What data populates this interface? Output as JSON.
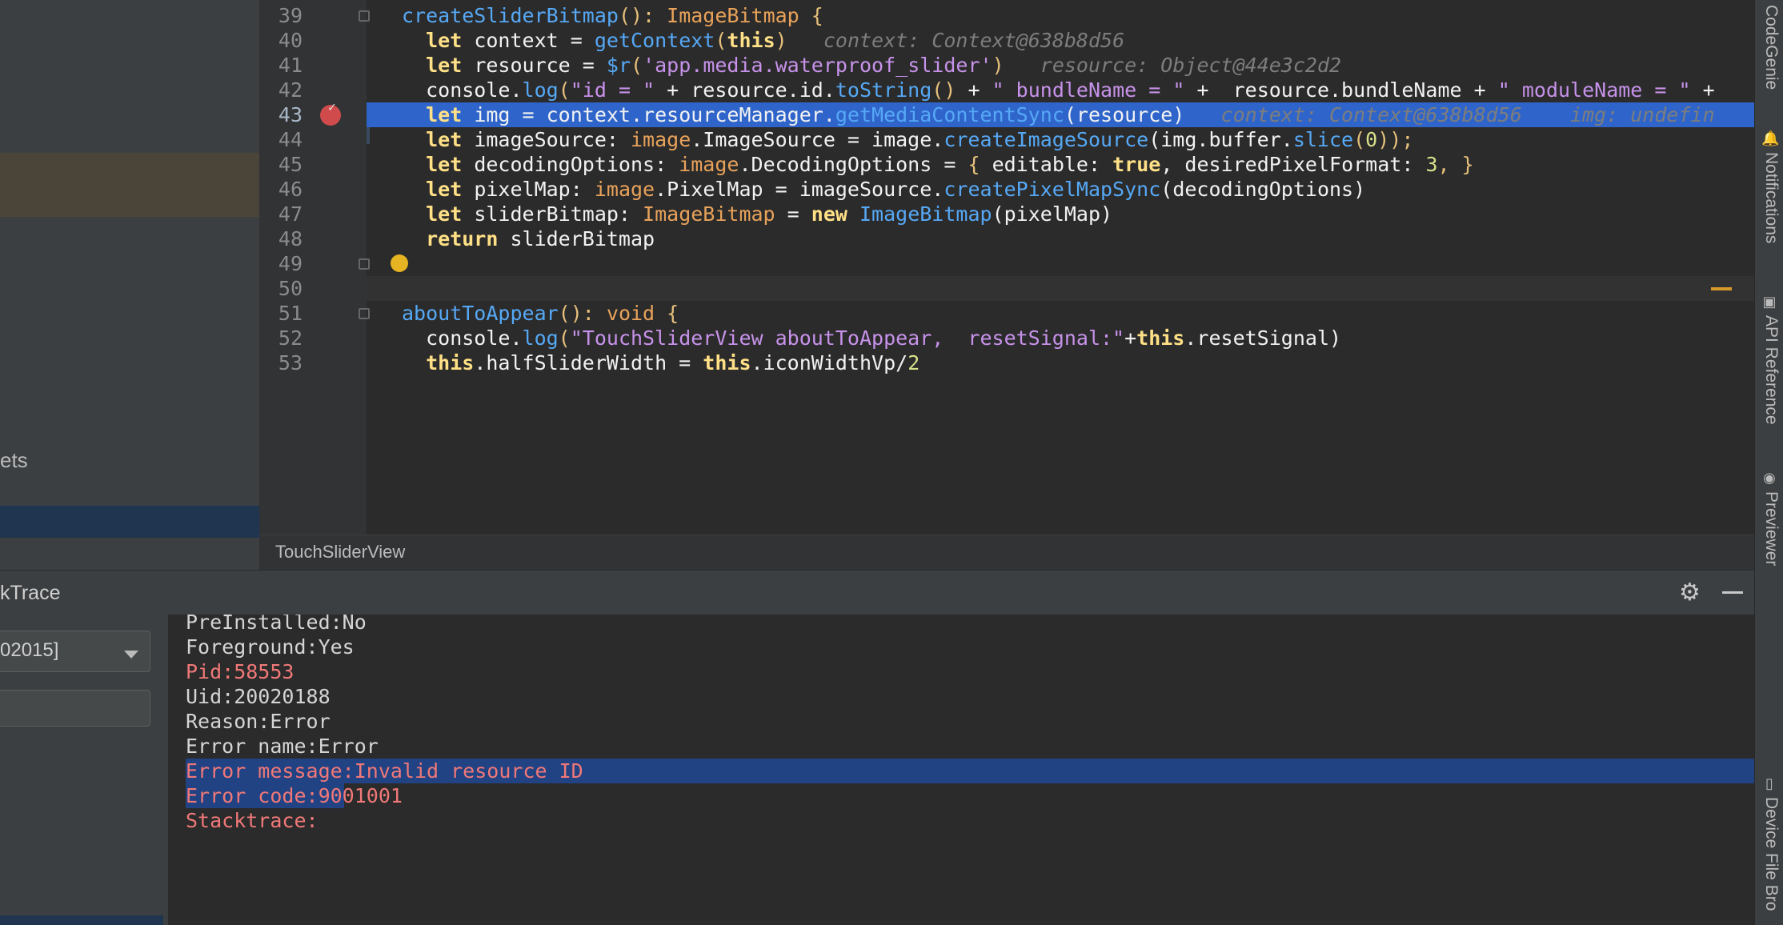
{
  "project_panel": {
    "partial_label": "ets"
  },
  "editor": {
    "lines": [
      {
        "num": "39",
        "segments": [
          {
            "t": "createSliderBitmap",
            "c": "fn"
          },
          {
            "t": "(): ",
            "c": "p"
          },
          {
            "t": "ImageBitmap",
            "c": "ty"
          },
          {
            "t": " {",
            "c": "p"
          }
        ]
      },
      {
        "num": "40",
        "segments": [
          {
            "t": "  let",
            "c": "k"
          },
          {
            "t": " context = ",
            "c": "white"
          },
          {
            "t": "getContext",
            "c": "fn"
          },
          {
            "t": "(",
            "c": "p"
          },
          {
            "t": "this",
            "c": "k"
          },
          {
            "t": ")",
            "c": "p"
          },
          {
            "t": "   context: Context@638b8d56",
            "c": "hint"
          }
        ]
      },
      {
        "num": "41",
        "segments": [
          {
            "t": "  let",
            "c": "k"
          },
          {
            "t": " resource = ",
            "c": "white"
          },
          {
            "t": "$r",
            "c": "fn"
          },
          {
            "t": "(",
            "c": "p"
          },
          {
            "t": "'app.media.waterproof_slider'",
            "c": "s"
          },
          {
            "t": ")",
            "c": "p"
          },
          {
            "t": "   resource: Object@44e3c2d2",
            "c": "hint"
          }
        ]
      },
      {
        "num": "42",
        "segments": [
          {
            "t": "  console.",
            "c": "white"
          },
          {
            "t": "log",
            "c": "fn"
          },
          {
            "t": "(",
            "c": "p"
          },
          {
            "t": "\"id = \"",
            "c": "s"
          },
          {
            "t": " + resource.id.",
            "c": "white"
          },
          {
            "t": "toString",
            "c": "fn"
          },
          {
            "t": "() ",
            "c": "p"
          },
          {
            "t": "+ ",
            "c": "white"
          },
          {
            "t": "\" bundleName = \"",
            "c": "s"
          },
          {
            "t": " +  resource.bundleName + ",
            "c": "white"
          },
          {
            "t": "\" moduleName = \"",
            "c": "s"
          },
          {
            "t": " +",
            "c": "white"
          }
        ]
      },
      {
        "num": "43",
        "segments": [
          {
            "t": "  let",
            "c": "k"
          },
          {
            "t": " img = context.resourceManager.",
            "c": "white"
          },
          {
            "t": "getMediaContentSync",
            "c": "fn"
          },
          {
            "t": "(resource)",
            "c": "white"
          },
          {
            "t": "   context: Context@638b8d56    img: undefin",
            "c": "hint"
          }
        ]
      },
      {
        "num": "44",
        "segments": [
          {
            "t": "  let",
            "c": "k"
          },
          {
            "t": " imageSource: ",
            "c": "white"
          },
          {
            "t": "image",
            "c": "ty"
          },
          {
            "t": ".ImageSource = image.",
            "c": "white"
          },
          {
            "t": "createImageSource",
            "c": "fn"
          },
          {
            "t": "(img.buffer.",
            "c": "white"
          },
          {
            "t": "slice",
            "c": "fn"
          },
          {
            "t": "(",
            "c": "p"
          },
          {
            "t": "0",
            "c": "n"
          },
          {
            "t": "));",
            "c": "p"
          }
        ]
      },
      {
        "num": "45",
        "segments": [
          {
            "t": "  let",
            "c": "k"
          },
          {
            "t": " decodingOptions: ",
            "c": "white"
          },
          {
            "t": "image",
            "c": "ty"
          },
          {
            "t": ".DecodingOptions = ",
            "c": "white"
          },
          {
            "t": "{",
            "c": "p"
          },
          {
            "t": " editable: ",
            "c": "white"
          },
          {
            "t": "true",
            "c": "k"
          },
          {
            "t": ", desiredPixelFormat: ",
            "c": "white"
          },
          {
            "t": "3",
            "c": "n"
          },
          {
            "t": ", }",
            "c": "p"
          }
        ]
      },
      {
        "num": "46",
        "segments": [
          {
            "t": "  let",
            "c": "k"
          },
          {
            "t": " pixelMap: ",
            "c": "white"
          },
          {
            "t": "image",
            "c": "ty"
          },
          {
            "t": ".PixelMap = imageSource.",
            "c": "white"
          },
          {
            "t": "createPixelMapSync",
            "c": "fn"
          },
          {
            "t": "(decodingOptions)",
            "c": "white"
          }
        ]
      },
      {
        "num": "47",
        "segments": [
          {
            "t": "  let",
            "c": "k"
          },
          {
            "t": " sliderBitmap: ",
            "c": "white"
          },
          {
            "t": "ImageBitmap",
            "c": "ty"
          },
          {
            "t": " = ",
            "c": "white"
          },
          {
            "t": "new",
            "c": "k"
          },
          {
            "t": " ",
            "c": "white"
          },
          {
            "t": "ImageBitmap",
            "c": "fn"
          },
          {
            "t": "(pixelMap)",
            "c": "white"
          }
        ]
      },
      {
        "num": "48",
        "segments": [
          {
            "t": "  return",
            "c": "k"
          },
          {
            "t": " sliderBitmap",
            "c": "white"
          }
        ]
      },
      {
        "num": "49",
        "segments": []
      },
      {
        "num": "50",
        "segments": []
      },
      {
        "num": "51",
        "segments": [
          {
            "t": "aboutToAppear",
            "c": "fn"
          },
          {
            "t": "(): ",
            "c": "p"
          },
          {
            "t": "void",
            "c": "ty"
          },
          {
            "t": " {",
            "c": "p"
          }
        ]
      },
      {
        "num": "52",
        "segments": [
          {
            "t": "  console.",
            "c": "white"
          },
          {
            "t": "log",
            "c": "fn"
          },
          {
            "t": "(",
            "c": "p"
          },
          {
            "t": "\"TouchSliderView aboutToAppear,  resetSignal:\"",
            "c": "s"
          },
          {
            "t": "+",
            "c": "white"
          },
          {
            "t": "this",
            "c": "k"
          },
          {
            "t": ".resetSignal)",
            "c": "white"
          }
        ]
      },
      {
        "num": "53",
        "segments": [
          {
            "t": "  this",
            "c": "k"
          },
          {
            "t": ".halfSliderWidth = ",
            "c": "white"
          },
          {
            "t": "this",
            "c": "k"
          },
          {
            "t": ".iconWidthVp/",
            "c": "white"
          },
          {
            "t": "2",
            "c": "n"
          }
        ]
      }
    ]
  },
  "breadcrumb": {
    "item": "TouchSliderView"
  },
  "tool_window": {
    "title": "kTrace",
    "process_select": "02015]",
    "filter_placeholder": ""
  },
  "log": {
    "lines": [
      {
        "text": "PreInstalled:No",
        "error": false,
        "selected": false
      },
      {
        "text": "Foreground:Yes",
        "error": false,
        "selected": false
      },
      {
        "text": "Pid:58553",
        "error": true,
        "selected": false
      },
      {
        "text": "Uid:20020188",
        "error": false,
        "selected": false
      },
      {
        "text": "Reason:Error",
        "error": false,
        "selected": false
      },
      {
        "text": "Error name:Error",
        "error": false,
        "selected": false
      },
      {
        "text": "Error message:Invalid resource ID",
        "error": true,
        "selected": true
      },
      {
        "text": "Error code:9001001",
        "error": true,
        "selected": true
      },
      {
        "text": "Stacktrace:",
        "error": true,
        "selected": false
      }
    ]
  },
  "right_stripe": {
    "tabs": [
      "CodeGenie",
      "Notifications",
      "API Reference",
      "Previewer",
      "Device File Bro"
    ]
  }
}
